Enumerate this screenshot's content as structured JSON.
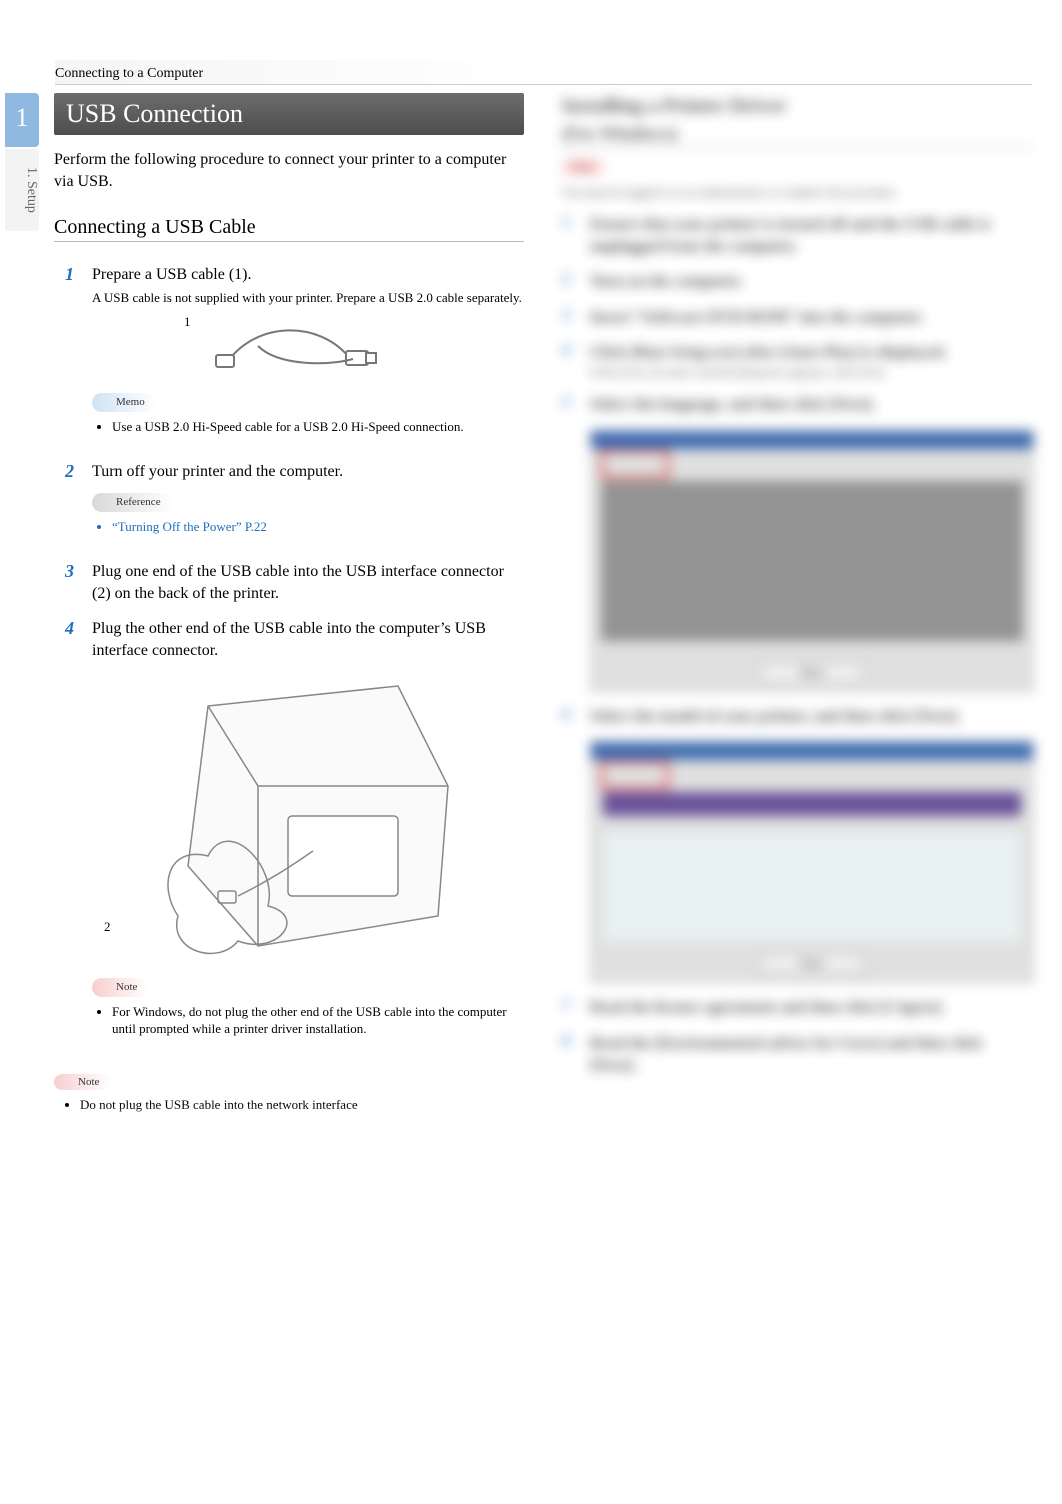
{
  "header": "Connecting to a Computer",
  "side": {
    "active_chapter_number": "1",
    "active_chapter_label": "1. Setup"
  },
  "left": {
    "title": "USB Connection",
    "intro": "Perform the following procedure to connect your printer to a computer via USB.",
    "subhead": "Connecting a USB Cable",
    "steps": [
      {
        "num": "1",
        "text": "Prepare a USB cable (1).",
        "note": "A USB cable is not supplied with your printer. Prepare a USB 2.0 cable separately.",
        "fig_label": "1",
        "memo_tag": "Memo",
        "memo_items": [
          "Use a USB 2.0 Hi-Speed cable for a USB 2.0 Hi-Speed connection."
        ]
      },
      {
        "num": "2",
        "text": "Turn off your printer and the computer.",
        "ref_tag": "Reference",
        "ref_items": [
          "“Turning Off the Power” P.22"
        ]
      },
      {
        "num": "3",
        "text": "Plug one end of the USB cable into the USB interface connector (2) on the back of the printer."
      },
      {
        "num": "4",
        "text": "Plug the other end of the USB cable into the computer’s USB interface connector.",
        "fig_label": "2",
        "note_tag": "Note",
        "note_items": [
          "For Windows, do not plug the other end of the USB cable into the computer until prompted while a printer driver installation."
        ]
      }
    ],
    "outer_note_tag": "Note",
    "outer_note_items": [
      "Do not plug the USB cable into the network interface"
    ]
  },
  "right": {
    "title": "Installing a Printer Driver",
    "subtitle": "(For Windows)",
    "note_tag": "Note",
    "note_text": "You must be logged in as an administrator to complete this procedure.",
    "steps": [
      {
        "num": "1",
        "text": "Ensure that your printer is turned off and the USB cable is unplugged from the computer."
      },
      {
        "num": "2",
        "text": "Turn on the computer."
      },
      {
        "num": "3",
        "text": "Insert “Software DVD-ROM” into the computer."
      },
      {
        "num": "4",
        "text": "Click [Run Setup.exe] after [Auto Play] is displayed.",
        "small": "If the [User Account Control] dialog box appears, click [Yes]."
      },
      {
        "num": "5",
        "text": "Select the language, and then click [Next]."
      },
      {
        "num": "6",
        "text": "Select the model of your printer, and then click [Next]."
      },
      {
        "num": "7",
        "text": "Read the license agreement and then click [I Agree]."
      },
      {
        "num": "8",
        "text": "Read the [Environmental advice for Users] and then click [Next]."
      }
    ],
    "button_label": "Next"
  }
}
